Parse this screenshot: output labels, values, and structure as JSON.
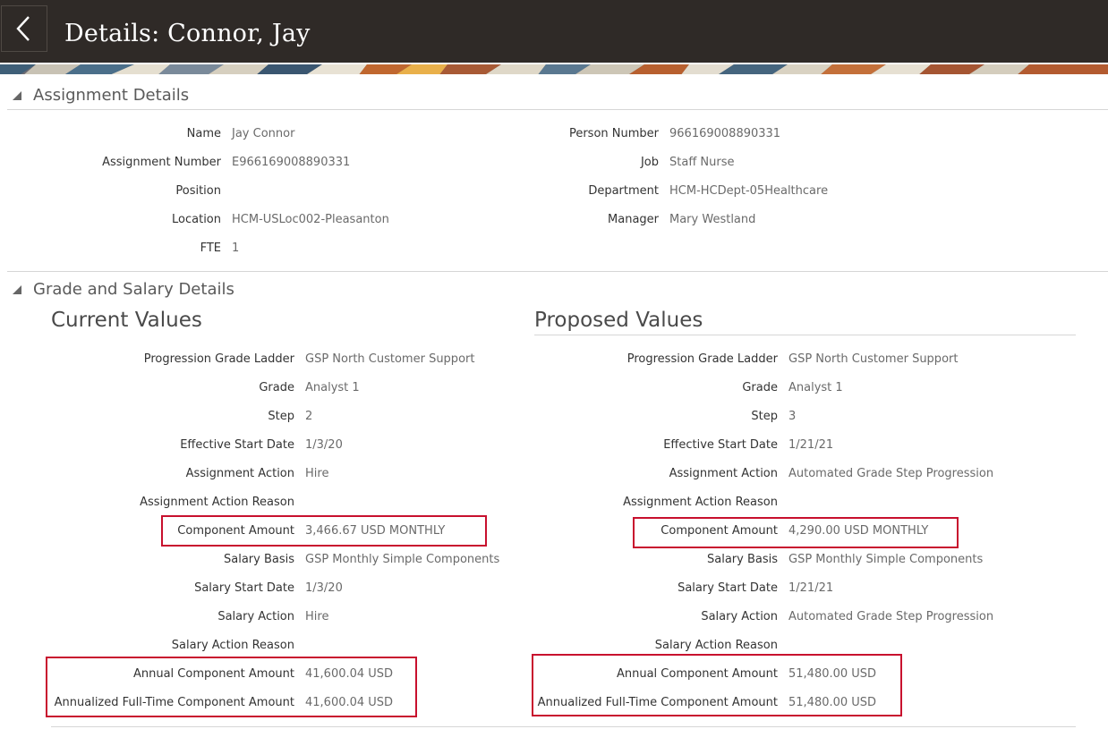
{
  "header": {
    "title": "Details: Connor, Jay"
  },
  "assignment_details": {
    "title": "Assignment Details",
    "left": [
      {
        "label": "Name",
        "value": "Jay Connor"
      },
      {
        "label": "Assignment Number",
        "value": "E966169008890331"
      },
      {
        "label": "Position",
        "value": ""
      },
      {
        "label": "Location",
        "value": "HCM-USLoc002-Pleasanton"
      },
      {
        "label": "FTE",
        "value": "1"
      }
    ],
    "right": [
      {
        "label": "Person Number",
        "value": "966169008890331"
      },
      {
        "label": "Job",
        "value": "Staff Nurse"
      },
      {
        "label": "Department",
        "value": "HCM-HCDept-05Healthcare"
      },
      {
        "label": "Manager",
        "value": "Mary Westland"
      }
    ]
  },
  "grade_salary": {
    "title": "Grade and Salary Details",
    "current": {
      "heading": "Current Values",
      "rows": [
        {
          "label": "Progression Grade Ladder",
          "value": "GSP North Customer Support"
        },
        {
          "label": "Grade",
          "value": "Analyst 1"
        },
        {
          "label": "Step",
          "value": "2"
        },
        {
          "label": "Effective Start Date",
          "value": "1/3/20"
        },
        {
          "label": "Assignment Action",
          "value": "Hire"
        },
        {
          "label": "Assignment Action Reason",
          "value": ""
        },
        {
          "label": "Component Amount",
          "value": "3,466.67 USD MONTHLY"
        },
        {
          "label": "Salary Basis",
          "value": "GSP Monthly Simple Components"
        },
        {
          "label": "Salary Start Date",
          "value": "1/3/20"
        },
        {
          "label": "Salary Action",
          "value": "Hire"
        },
        {
          "label": "Salary Action Reason",
          "value": ""
        },
        {
          "label": "Annual Component Amount",
          "value": "41,600.04 USD"
        },
        {
          "label": "Annualized Full-Time Component Amount",
          "value": "41,600.04 USD"
        }
      ]
    },
    "proposed": {
      "heading": "Proposed Values",
      "rows": [
        {
          "label": "Progression Grade Ladder",
          "value": "GSP North Customer Support"
        },
        {
          "label": "Grade",
          "value": "Analyst 1"
        },
        {
          "label": "Step",
          "value": "3"
        },
        {
          "label": "Effective Start Date",
          "value": "1/21/21"
        },
        {
          "label": "Assignment Action",
          "value": "Automated Grade Step Progression"
        },
        {
          "label": "Assignment Action Reason",
          "value": ""
        },
        {
          "label": "Component Amount",
          "value": "4,290.00 USD MONTHLY"
        },
        {
          "label": "Salary Basis",
          "value": "GSP Monthly Simple Components"
        },
        {
          "label": "Salary Start Date",
          "value": "1/21/21"
        },
        {
          "label": "Salary Action",
          "value": "Automated Grade Step Progression"
        },
        {
          "label": "Salary Action Reason",
          "value": ""
        },
        {
          "label": "Annual Component Amount",
          "value": "51,480.00 USD"
        },
        {
          "label": "Annualized Full-Time Component Amount",
          "value": "51,480.00 USD"
        }
      ]
    }
  },
  "colors": {
    "header_bg": "#2f2a27",
    "highlight": "#c8102e"
  }
}
